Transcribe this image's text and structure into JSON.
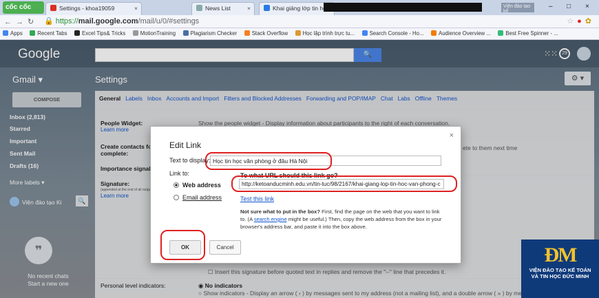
{
  "browser": {
    "logo": "cốc cốc",
    "tabs": [
      {
        "label": "Settings - khoa19059",
        "color": "#d93025"
      },
      {
        "label": "News List",
        "color": "#8aa"
      },
      {
        "label": "Khai giảng lớp tin họ",
        "color": "#2a7be0"
      }
    ],
    "ad_button": "Viện đào tạo kế",
    "window_controls": [
      "–",
      "□",
      "×"
    ],
    "url_prefix": "https://",
    "url_host": "mail.google.com",
    "url_path": "/mail/u/0/#settings",
    "bookmarks": [
      {
        "label": "Apps",
        "color": "#4285f4"
      },
      {
        "label": "Recent Tabs",
        "color": "#34a853"
      },
      {
        "label": "Excel Tips& Tricks",
        "color": "#222"
      },
      {
        "label": "MotionTraining",
        "color": "#999"
      },
      {
        "label": "Plagiarism Checker",
        "color": "#4a6fa5"
      },
      {
        "label": "Stack Overflow",
        "color": "#f48024"
      },
      {
        "label": "Học lập trình trực tu...",
        "color": "#d93"
      },
      {
        "label": "Search Console - Ho...",
        "color": "#4285f4"
      },
      {
        "label": "Audience Overview ...",
        "color": "#f57c00"
      },
      {
        "label": "Best Free Spinner - ...",
        "color": "#3b7"
      }
    ]
  },
  "gmail": {
    "logo": "Google",
    "search_button_icon": "🔍",
    "notification_count": "29",
    "app_label": "Gmail ▾",
    "page_title": "Settings",
    "gear": "⚙ ▾",
    "compose": "COMPOSE",
    "nav": [
      "Inbox (2,813)",
      "Starred",
      "Important",
      "Sent Mail",
      "Drafts (16)",
      "More labels ▾"
    ],
    "hangout_user": "Viện đào tạo Ki",
    "no_chats": "No recent chats",
    "start_new": "Start a new one",
    "settings_tabs": [
      "General",
      "Labels",
      "Inbox",
      "Accounts and Import",
      "Filters and Blocked Addresses",
      "Forwarding and POP/IMAP",
      "Chat",
      "Labs",
      "Offline",
      "Themes"
    ],
    "rows": {
      "people_widget": "People Widget:",
      "learn_more": "Learn more",
      "people_widget_text": "Show the people widget - Display information about participants to the right of each conversation.",
      "create_contacts": "Create contacts for",
      "complete": "complete:",
      "create_contacts_text": "ete to them next time",
      "importance": "Importance signals",
      "signature": "Signature:",
      "signature_sub": "(appended at the end of all outgoing messages)",
      "signature_learn": "Learn more",
      "insert_sig": "Insert this signature before quoted text in replies and remove the \"--\" line that precedes it.",
      "personal_level": "Personal level indicators:",
      "no_indicators": "No indicators",
      "show_indicators": "Show indicators - Display an arrow ( › ) by messages sent to my address (not a mailing list), and a double arrow ( » ) by mess"
    }
  },
  "dialog": {
    "title": "Edit Link",
    "close": "×",
    "text_to_display_label": "Text to display:",
    "text_to_display_value": "Học tin học văn phòng ở đâu Hà Nội",
    "link_to_label": "Link to:",
    "web_address": "Web address",
    "email_address": "Email address",
    "url_question": "To what URL should this link go?",
    "url_value": "http://ketoanducminh.edu.vn/tin-tuc/98/2167/khai-giang-lop-tin-hoc-van-phong-c",
    "test_link": "Test this link",
    "help_bold": "Not sure what to put in the box?",
    "help_1": "First, find the page on the web that you want to link to. (A",
    "help_link": "search engine",
    "help_2": "might be useful.) Then, copy the web address from the box in your browser's address bar, and paste it into the box above.",
    "ok": "OK",
    "cancel": "Cancel"
  },
  "brand": {
    "mark": "ĐM",
    "line1": "VIỆN ĐÀO TẠO KẾ TOÁN",
    "line2": "VÀ TIN HỌC ĐỨC MINH"
  }
}
